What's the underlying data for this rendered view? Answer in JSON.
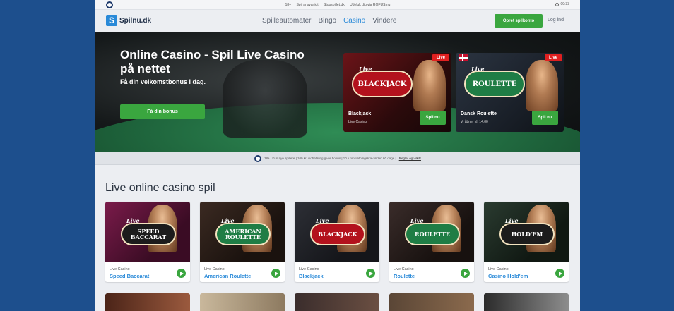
{
  "topbar": {
    "links": [
      "18+",
      "Spil ansvarligt",
      "Stopspillet.dk",
      "Udeluk dig via ROFUS.nu"
    ],
    "time": "09:33"
  },
  "header": {
    "logo_text": "Spilnu.dk",
    "nav": [
      "Spilleautomater",
      "Bingo",
      "Casino",
      "Vindere"
    ],
    "active_nav": "Casino",
    "signup_label": "Opret spilkonto",
    "login_label": "Log ind"
  },
  "hero": {
    "title": "Online Casino - Spil Live Casino på nettet",
    "subtitle": "Få din velkomstbonus i dag.",
    "cta_label": "Få din bonus",
    "promos": [
      {
        "badge": "BLACKJACK",
        "badge_script": "Live",
        "live": "Live",
        "title": "Blackjack",
        "subtitle": "Live Casino",
        "play": "Spil nu"
      },
      {
        "badge": "ROULETTE",
        "badge_script": "Live",
        "live": "Live",
        "title": "Dansk Roulette",
        "subtitle": "Vi åbner kl. 14.00",
        "play": "Spil nu"
      }
    ]
  },
  "notice": {
    "text": "18+ | Kun nye spillere | 100 kr. indbetaling giver bonus | 10 x omsætningskrav inden 60 dage |",
    "link": "Regler og vilkår"
  },
  "section": {
    "title": "Live online casino spil",
    "cards": [
      {
        "badge": "SPEED BACCARAT",
        "badge_script": "Live",
        "category": "Live Casino",
        "name": "Speed Baccarat"
      },
      {
        "badge": "AMERICAN ROULETTE",
        "badge_script": "Live",
        "category": "Live Casino",
        "name": "American Roulette"
      },
      {
        "badge": "BLACKJACK",
        "badge_script": "Live",
        "category": "Live Casino",
        "name": "Blackjack"
      },
      {
        "badge": "ROULETTE",
        "badge_script": "Live",
        "category": "Live Casino",
        "name": "Roulette"
      },
      {
        "badge": "HOLD'EM",
        "badge_script": "Live",
        "category": "Live Casino",
        "name": "Casino Hold'em"
      }
    ]
  },
  "colors": {
    "background": "#1d4f8d",
    "accent_green": "#3aa63f",
    "link_blue": "#2a8ad8",
    "live_red": "#e02020"
  }
}
